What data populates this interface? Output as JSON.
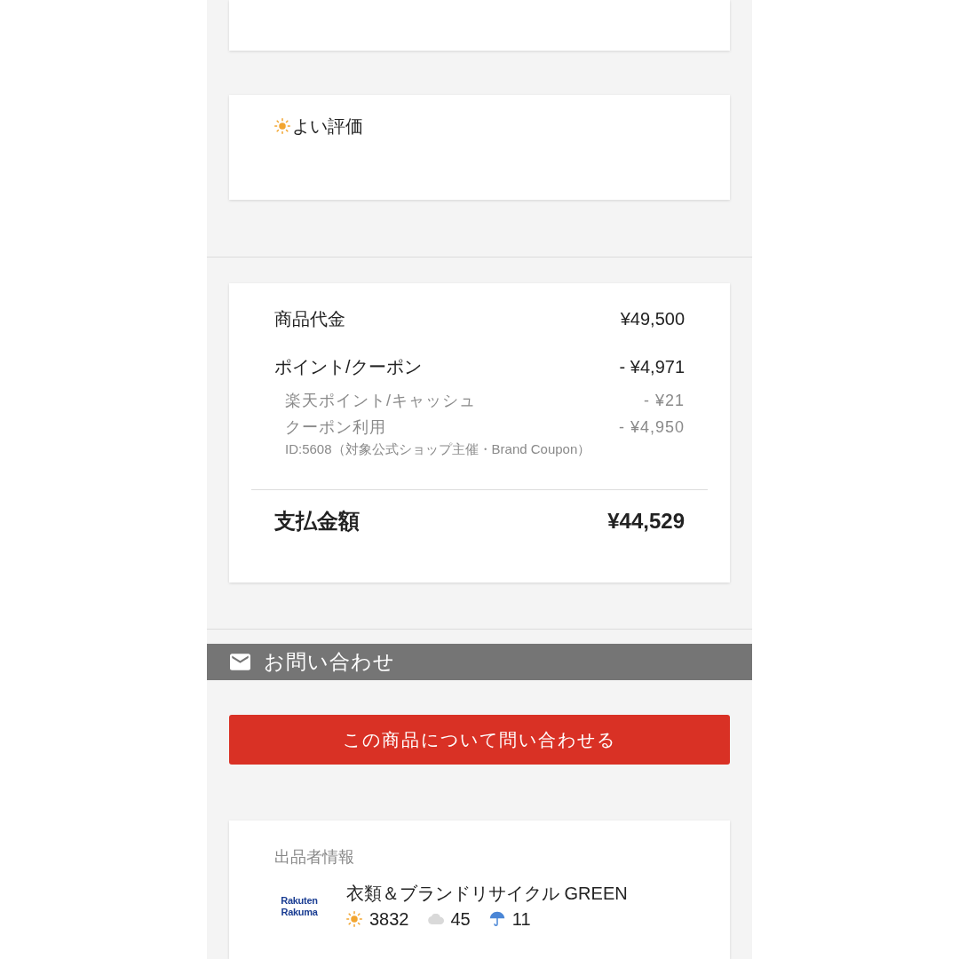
{
  "rating_card": {
    "kind": "good",
    "label": "よい評価"
  },
  "payment": {
    "rows": [
      {
        "kind": "main",
        "label": "商品代金",
        "amount": "¥49,500"
      },
      {
        "kind": "main",
        "label": "ポイント/クーポン",
        "amount": "- ¥4,971"
      },
      {
        "kind": "sub",
        "label": "楽天ポイント/キャッシュ",
        "amount": "- ¥21"
      },
      {
        "kind": "sub",
        "label": "クーポン利用",
        "amount": "- ¥4,950",
        "note": "ID:5608（対象公式ショップ主催・Brand Coupon）"
      }
    ],
    "total": {
      "label": "支払金額",
      "amount": "¥44,529"
    }
  },
  "contact": {
    "title": "お問い合わせ",
    "button": "この商品について問い合わせる"
  },
  "seller": {
    "heading": "出品者情報",
    "logo": [
      "Rakuten",
      "Rakuma"
    ],
    "name": "衣類＆ブランドリサイクル GREEN",
    "ratings": [
      {
        "kind": "good",
        "count": "3832"
      },
      {
        "kind": "normal",
        "count": "45"
      },
      {
        "kind": "bad",
        "count": "11"
      }
    ]
  }
}
